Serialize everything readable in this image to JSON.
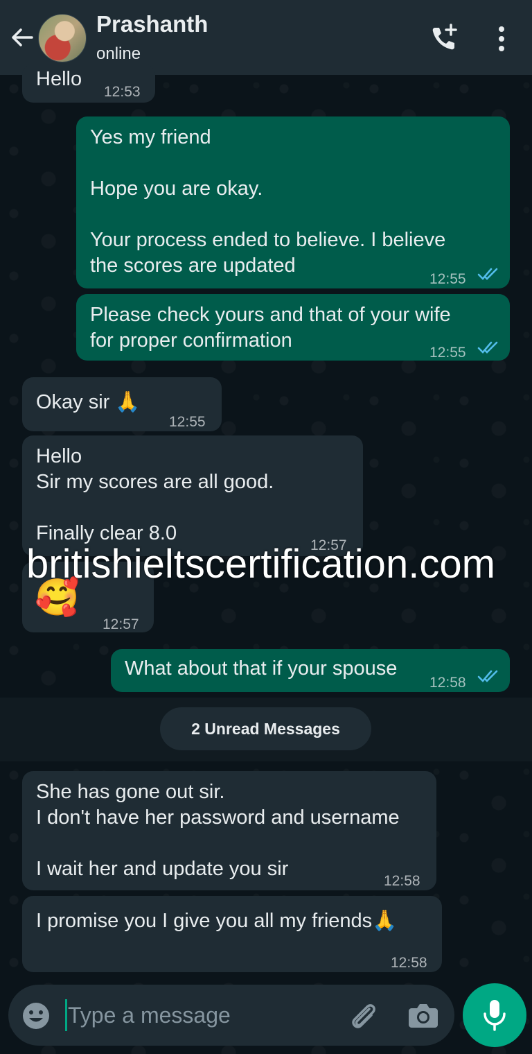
{
  "header": {
    "contact_name": "Prashanth",
    "status": "online",
    "icons": [
      "back-arrow-icon",
      "avatar",
      "call-add-icon",
      "more-vertical-icon"
    ]
  },
  "messages": [
    {
      "direction": "in",
      "text": "Hello",
      "time": "12:53"
    },
    {
      "direction": "out",
      "text": "Yes my friend\n\nHope you are okay.\n\nYour process ended to believe. I believe\nthe scores are updated",
      "time": "12:55",
      "status": "read"
    },
    {
      "direction": "out",
      "text": "Please check yours and that of your wife\nfor proper confirmation",
      "time": "12:55",
      "status": "read"
    },
    {
      "direction": "in",
      "text": "Okay sir 🙏",
      "time": "12:55"
    },
    {
      "direction": "in",
      "text": "Hello\nSir my scores are all good.\n\nFinally clear 8.0",
      "time": "12:57"
    },
    {
      "direction": "in",
      "text": "🥰",
      "time": "12:57"
    },
    {
      "direction": "out",
      "text": "What about that if your spouse",
      "time": "12:58",
      "status": "read"
    },
    {
      "direction": "in",
      "text": "She has gone out sir.\nI don't have her password and username\n\nI wait her and update you sir",
      "time": "12:58"
    },
    {
      "direction": "in",
      "text": "I promise you I give you all my friends🙏",
      "time": "12:58"
    }
  ],
  "unread_label": "2 Unread Messages",
  "watermark": "britishieltscertification.com",
  "composer": {
    "placeholder": "Type a message",
    "icons": [
      "emoji-icon",
      "attach-icon",
      "camera-icon",
      "mic-icon"
    ]
  },
  "colors": {
    "header_bg": "#1f2c34",
    "chat_bg": "#0b141a",
    "incoming_bubble": "#1f2c34",
    "outgoing_bubble": "#005c4b",
    "accent": "#00a884",
    "read_ticks": "#53bdeb"
  }
}
